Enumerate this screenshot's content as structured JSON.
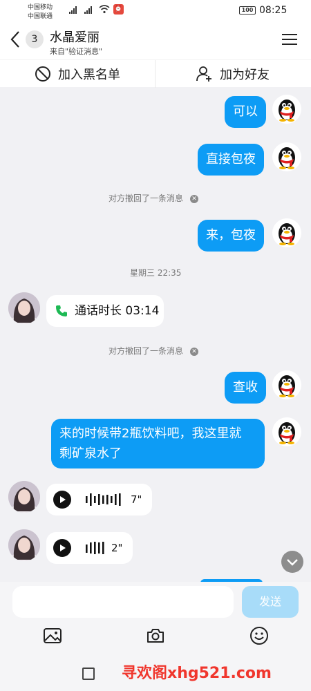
{
  "status": {
    "carrier_1": "中国移动",
    "carrier_2": "中国联通",
    "battery": "100",
    "time": "08:25"
  },
  "header": {
    "back_count": "3",
    "title": "水晶爱丽",
    "subtitle": "来自\"验证消息\""
  },
  "actions": {
    "blacklist": "加入黑名单",
    "add_friend": "加为好友"
  },
  "messages": {
    "m1": "可以",
    "m2": "直接包夜",
    "recall_1": "对方撤回了一条消息",
    "m3": "来，包夜",
    "timestamp": "星期三 22:35",
    "call_label": "通话时长 03:14",
    "recall_2": "对方撤回了一条消息",
    "m4": "查收",
    "m5_line1": "来的时候带2瓶饮料吧，我这里就",
    "m5_line2": "剩矿泉水了",
    "voice_1_duration": "7\"",
    "voice_2_duration": "2\""
  },
  "composer": {
    "send_label": "发送"
  },
  "watermark": "寻欢阁xhg521.com",
  "colors": {
    "accent": "#0d9cf5",
    "send_disabled": "#a8dcf9",
    "call_green": "#1db954",
    "watermark": "#f0362d"
  }
}
